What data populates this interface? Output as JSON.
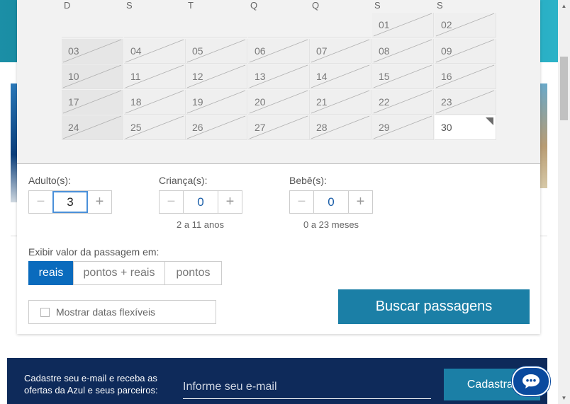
{
  "calendar": {
    "weekdays": [
      "D",
      "S",
      "T",
      "Q",
      "Q",
      "S",
      "S"
    ],
    "rows": [
      [
        "",
        "",
        "",
        "",
        "",
        "01",
        "02"
      ],
      [
        "03",
        "04",
        "05",
        "06",
        "07",
        "08",
        "09"
      ],
      [
        "10",
        "11",
        "12",
        "13",
        "14",
        "15",
        "16"
      ],
      [
        "17",
        "18",
        "19",
        "20",
        "21",
        "22",
        "23"
      ],
      [
        "24",
        "25",
        "26",
        "27",
        "28",
        "29",
        "30"
      ]
    ],
    "available_days": [
      "30"
    ]
  },
  "passengers": {
    "adults": {
      "label": "Adulto(s):",
      "value": "3",
      "hint": ""
    },
    "children": {
      "label": "Criança(s):",
      "value": "0",
      "hint": "2 a 11 anos"
    },
    "infants": {
      "label": "Bebê(s):",
      "value": "0",
      "hint": "0 a 23 meses"
    },
    "minus": "−",
    "plus": "+"
  },
  "fare_display": {
    "label": "Exibir valor da passagem em:",
    "options": [
      "reais",
      "pontos + reais",
      "pontos"
    ],
    "selected": "reais"
  },
  "flexible_dates": {
    "label": "Mostrar datas flexíveis",
    "checked": false
  },
  "search_button": "Buscar passagens",
  "newsletter": {
    "text": "Cadastre seu e-mail e receba as ofertas da Azul e seus parceiros:",
    "placeholder": "Informe seu e-mail",
    "button": "Cadastrar"
  },
  "icons": {
    "chat": "chat-bubble-icon",
    "checkbox": "checkbox-icon"
  },
  "colors": {
    "primary": "#0a6bbd",
    "search": "#1b7fa6",
    "footer": "#0e2a5a"
  }
}
